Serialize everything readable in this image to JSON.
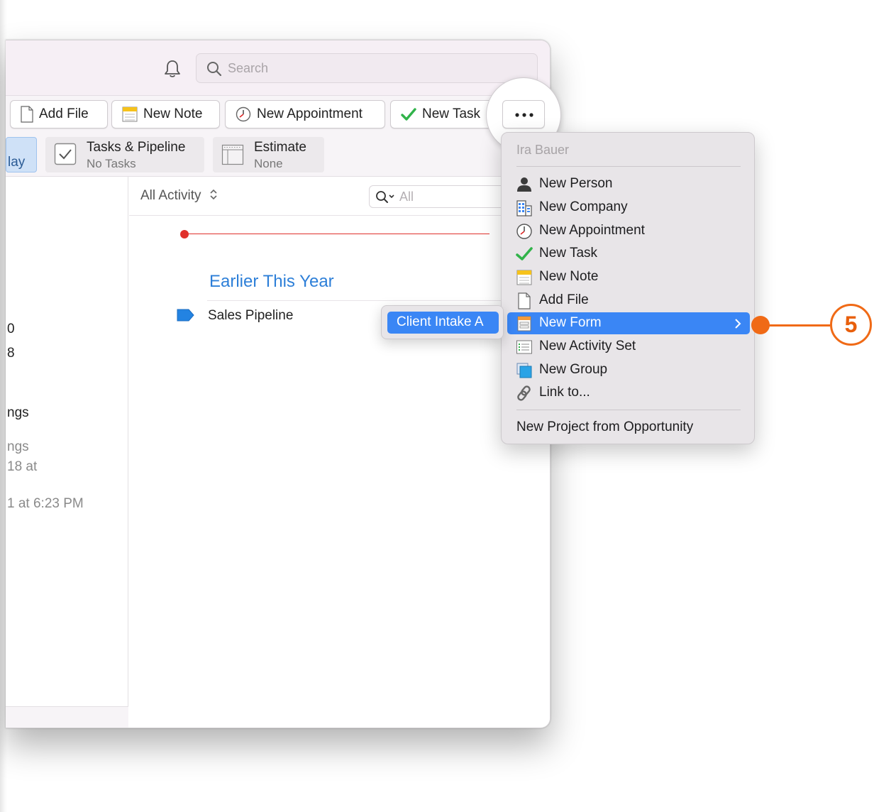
{
  "header": {
    "search_placeholder": "Search"
  },
  "toolbar": {
    "add_file": "Add File",
    "new_note": "New Note",
    "new_appointment": "New Appointment",
    "new_task": "New Task"
  },
  "tabs": [
    {
      "label": "lay",
      "sub": ""
    },
    {
      "label": "Tasks & Pipeline",
      "sub": "No Tasks"
    },
    {
      "label": "Estimate",
      "sub": "None"
    }
  ],
  "left_pane": {
    "fragments": [
      "0",
      "8",
      "ngs",
      "ngs",
      "18 at",
      "1 at 6:23 PM"
    ]
  },
  "activity": {
    "filter_label": "All Activity",
    "filter_search": "All",
    "section_title": "Earlier This Year",
    "item_label": "Sales Pipeline"
  },
  "menu": {
    "header": "Ira Bauer",
    "items": [
      {
        "label": "New Person",
        "icon": "person-icon"
      },
      {
        "label": "New Company",
        "icon": "company-icon"
      },
      {
        "label": "New Appointment",
        "icon": "clock-icon"
      },
      {
        "label": "New Task",
        "icon": "checkmark-icon"
      },
      {
        "label": "New Note",
        "icon": "note-icon"
      },
      {
        "label": "Add File",
        "icon": "file-icon"
      },
      {
        "label": "New Form",
        "icon": "form-icon",
        "selected": true
      },
      {
        "label": "New Activity Set",
        "icon": "activity-set-icon"
      },
      {
        "label": "New Group",
        "icon": "group-icon"
      },
      {
        "label": "Link to...",
        "icon": "link-icon"
      }
    ],
    "footer_item": "New Project from Opportunity"
  },
  "submenu": {
    "item": "Client Intake A"
  },
  "callout": {
    "number": "5",
    "color": "#f06a16"
  },
  "colors": {
    "accent": "#3a86f5",
    "section_title": "#2d7fd8",
    "today_line": "#e0302b"
  }
}
